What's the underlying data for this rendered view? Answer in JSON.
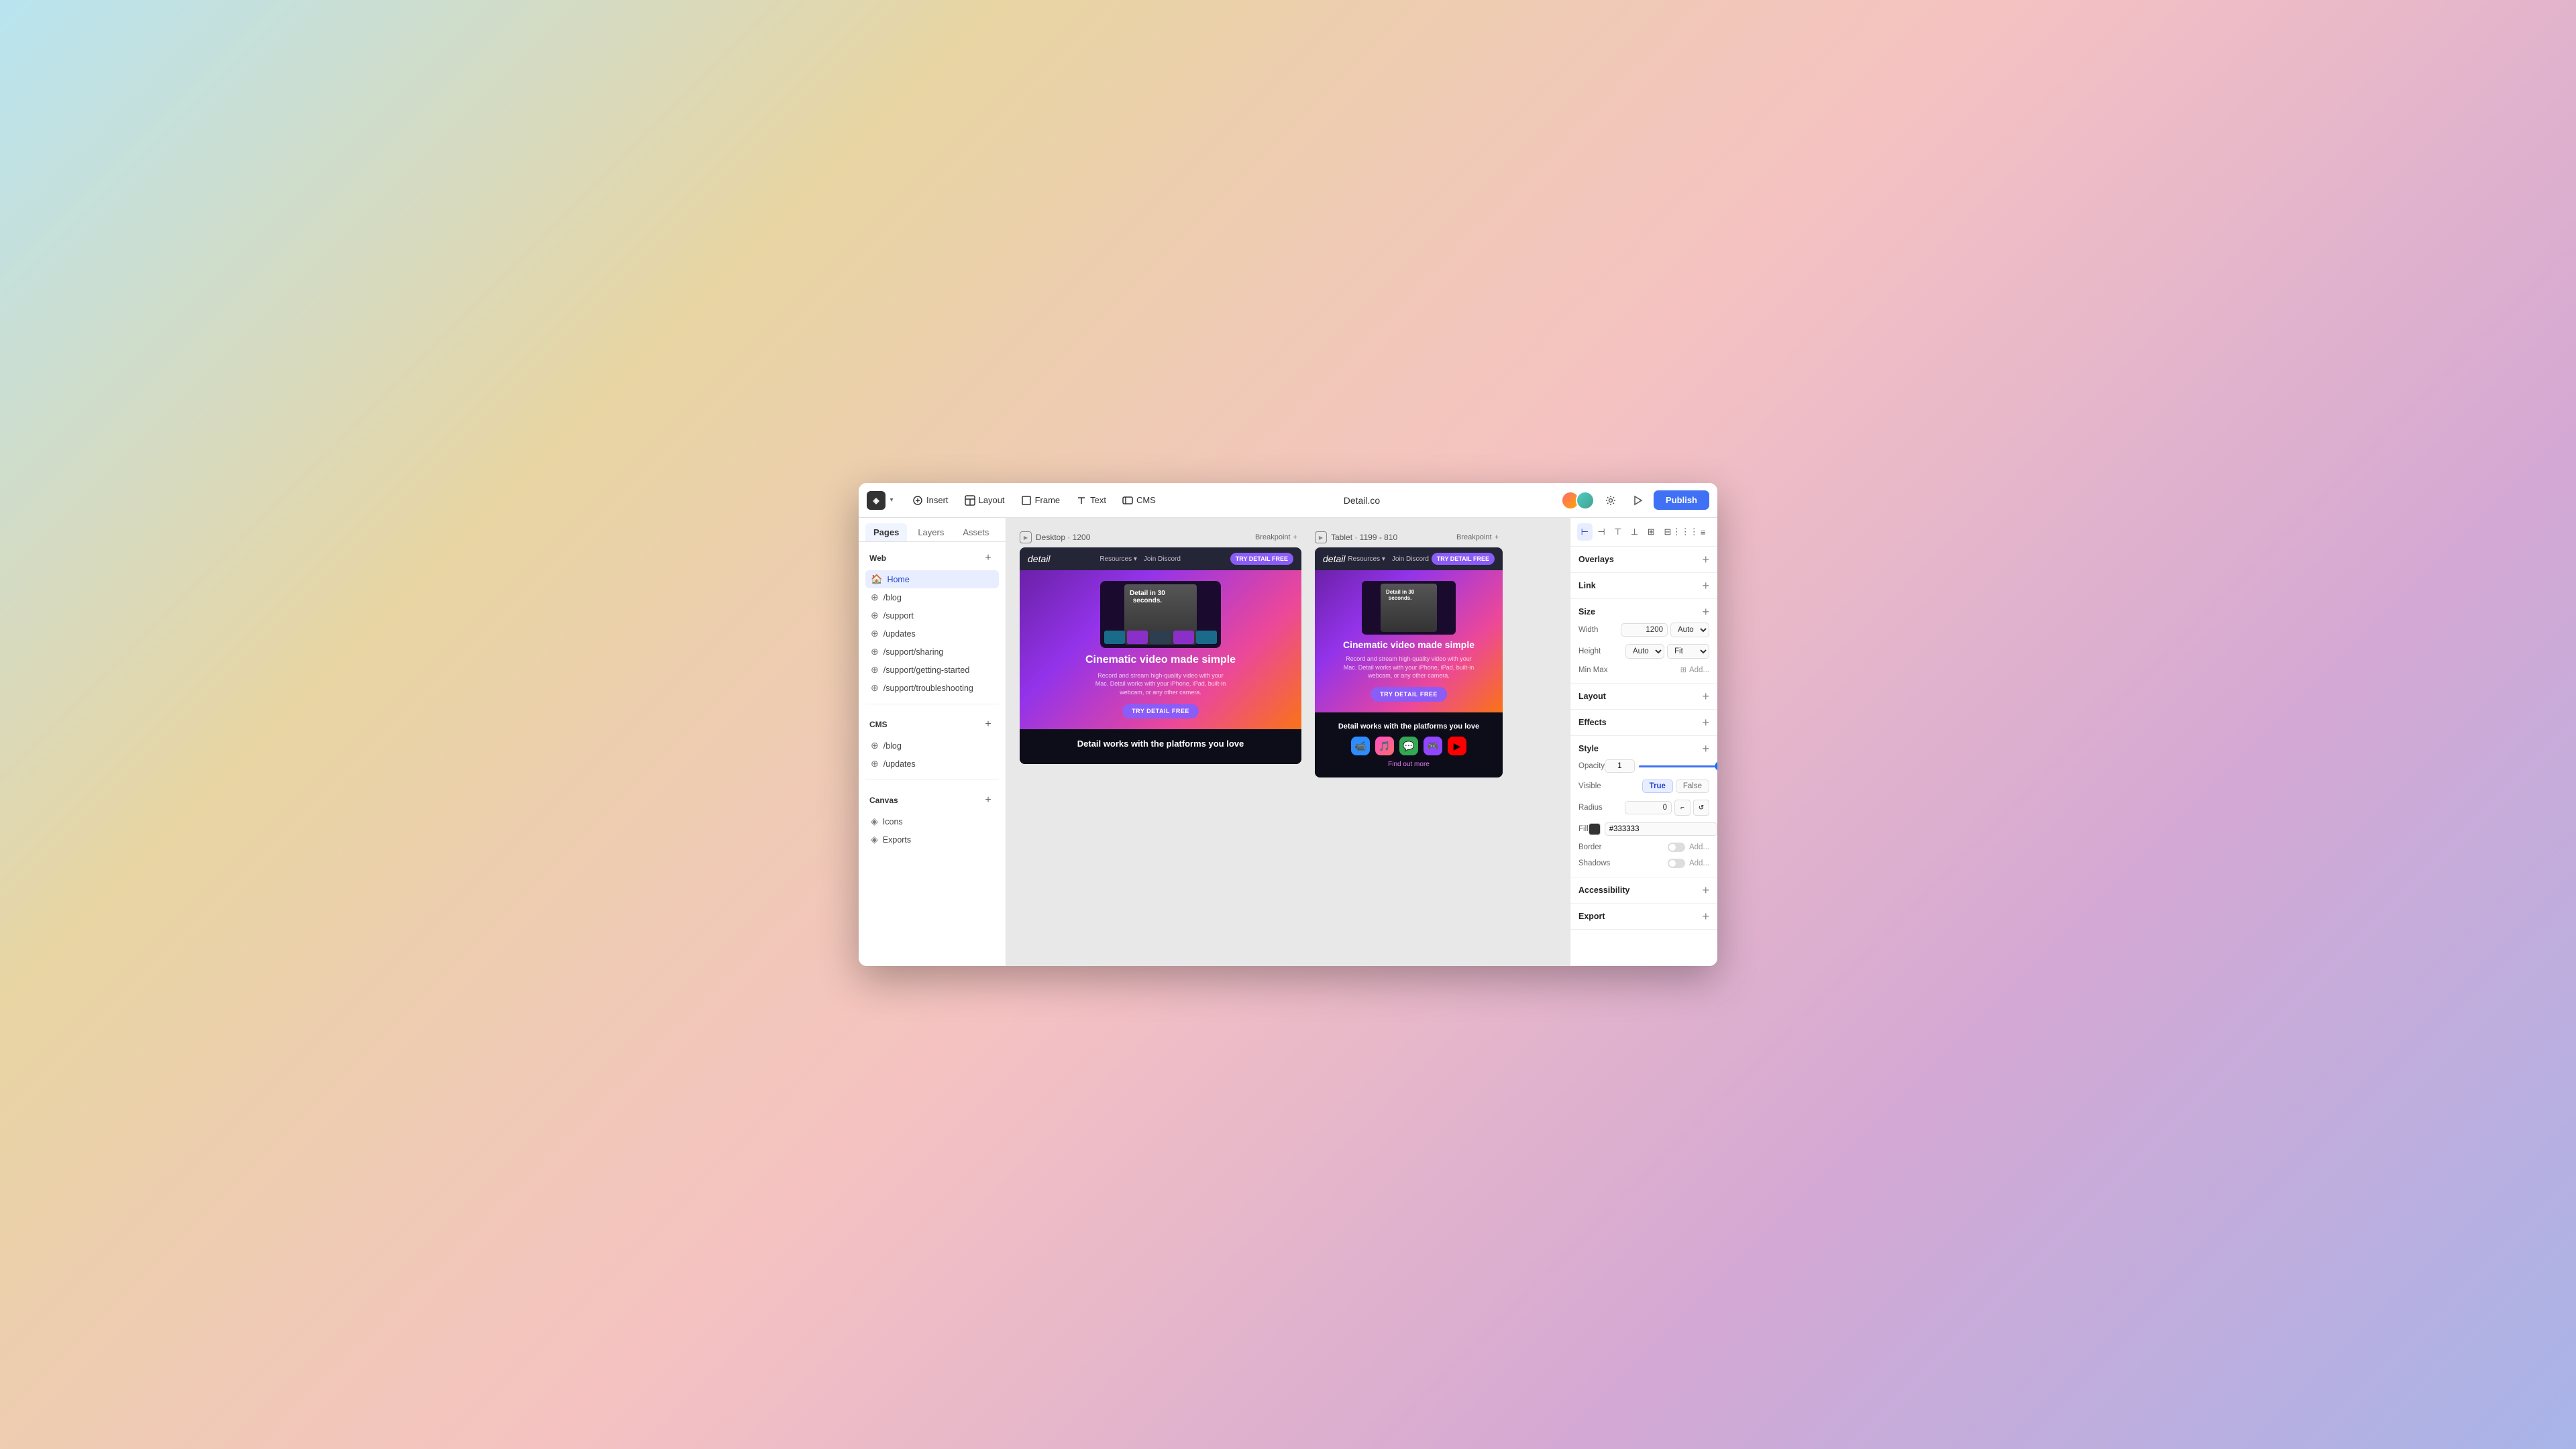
{
  "app": {
    "title": "Detail.co"
  },
  "toolbar": {
    "logo_label": "◈",
    "insert_label": "Insert",
    "layout_label": "Layout",
    "frame_label": "Frame",
    "text_label": "Text",
    "cms_label": "CMS",
    "publish_label": "Publish"
  },
  "sidebar": {
    "tabs": [
      {
        "id": "pages",
        "label": "Pages"
      },
      {
        "id": "layers",
        "label": "Layers"
      },
      {
        "id": "assets",
        "label": "Assets"
      }
    ],
    "web_section_title": "Web",
    "web_items": [
      {
        "icon": "🏠",
        "label": "Home",
        "active": true
      },
      {
        "icon": "⊕",
        "label": "/blog"
      },
      {
        "icon": "⊕",
        "label": "/support"
      },
      {
        "icon": "⊕",
        "label": "/updates"
      },
      {
        "icon": "⊕",
        "label": "/support/sharing"
      },
      {
        "icon": "⊕",
        "label": "/support/getting-started"
      },
      {
        "icon": "⊕",
        "label": "/support/troubleshooting"
      }
    ],
    "cms_section_title": "CMS",
    "cms_items": [
      {
        "icon": "⊕",
        "label": "/blog"
      },
      {
        "icon": "⊕",
        "label": "/updates"
      }
    ],
    "canvas_section_title": "Canvas",
    "canvas_items": [
      {
        "icon": "◈",
        "label": "Icons"
      },
      {
        "icon": "◈",
        "label": "Exports"
      }
    ]
  },
  "canvas": {
    "desktop_frame_label": "Desktop · 1200",
    "desktop_breakpoint": "Breakpoint",
    "tablet_frame_label": "Tablet · 1199 - 810",
    "tablet_breakpoint": "Breakpoint",
    "desktop_preview": {
      "logo": "detail",
      "nav_links": [
        "Resources ▾",
        "Join Discord"
      ],
      "cta_nav": "TRY DETAIL FREE",
      "hero_title": "Detail in 30 seconds.",
      "hero_heading": "Cinematic video made simple",
      "hero_sub": "Record and stream high-quality video with your Mac. Detail works with your iPhone, iPad, built-in webcam, or any other camera.",
      "cta_main": "TRY DETAIL FREE",
      "platforms_title": "Detail works with\nthe platforms you love"
    },
    "tablet_preview": {
      "logo": "detail",
      "nav_links": [
        "Resources ▾",
        "Join Discord"
      ],
      "cta_nav": "TRY DETAIL FREE",
      "hero_title": "Detail in 30 seconds.",
      "hero_heading": "Cinematic video made simple",
      "hero_sub": "Record and stream high-quality video with your Mac. Detail works with your iPhone, iPad, built-in webcam, or any other camera.",
      "cta_main": "TRY DETAIL FREE",
      "platforms_title": "Detail works with the platforms you love",
      "find_out": "Find out more",
      "platform_icons": [
        "📹",
        "🎵",
        "💬",
        "🎮",
        "▶"
      ]
    }
  },
  "right_panel": {
    "sections": {
      "overlays_title": "Overlays",
      "link_title": "Link",
      "size_title": "Size",
      "layout_title": "Layout",
      "effects_title": "Effects",
      "style_title": "Style",
      "accessibility_title": "Accessibility",
      "export_title": "Export"
    },
    "size": {
      "width_label": "Width",
      "width_value": "1200",
      "width_unit": "Auto",
      "height_label": "Height",
      "height_value": "Auto",
      "height_unit": "Fit",
      "minmax_label": "Min Max",
      "minmax_placeholder": "Add..."
    },
    "style": {
      "opacity_label": "Opacity",
      "opacity_value": "1",
      "visible_label": "Visible",
      "visible_true": "True",
      "visible_false": "False",
      "radius_label": "Radius",
      "radius_value": "0",
      "fill_label": "Fill",
      "fill_color": "#333333",
      "border_label": "Border",
      "border_placeholder": "Add...",
      "shadows_label": "Shadows",
      "shadows_placeholder": "Add..."
    },
    "align_icons": [
      "⊢",
      "⊣",
      "⊤",
      "⊥",
      "⊞",
      "⊟",
      "⋮⋮⋮",
      "≡"
    ]
  }
}
